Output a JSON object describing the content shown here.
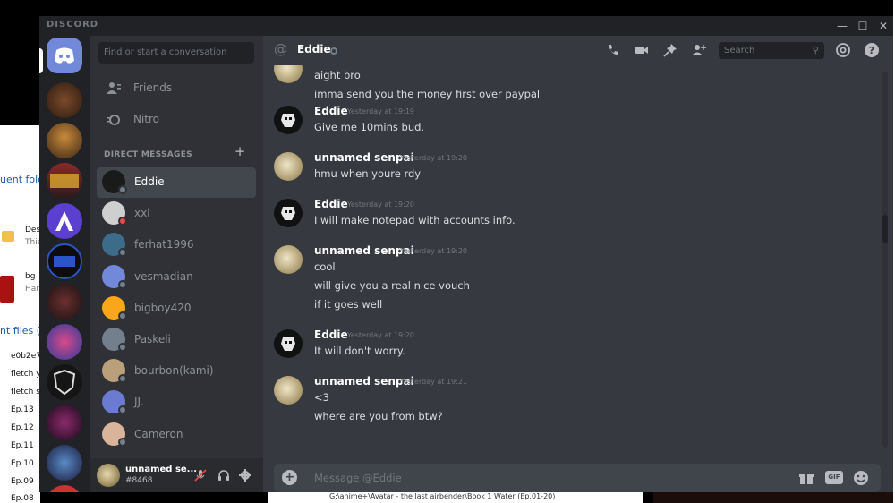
{
  "app": {
    "brand": "DISCORD"
  },
  "window_controls": {
    "minimize": "—",
    "maximize": "☐",
    "close": "✕"
  },
  "background": {
    "explorer_rows": [
      {
        "text": "uent fold",
        "top": 0
      },
      {
        "text": "Des",
        "top": 0
      },
      {
        "text": "This",
        "top": 0
      },
      {
        "text": "bg",
        "top": 0
      },
      {
        "text": "Har",
        "top": 0
      },
      {
        "text": "nt files (",
        "top": 0
      },
      {
        "text": "e0b2e7",
        "top": 0
      },
      {
        "text": "fletch y",
        "top": 0
      },
      {
        "text": "fletch s",
        "top": 0
      },
      {
        "text": "Ep.13",
        "top": 0
      },
      {
        "text": "Ep.12",
        "top": 0
      },
      {
        "text": "Ep.11",
        "top": 0
      },
      {
        "text": "Ep.10",
        "top": 0
      },
      {
        "text": "Ep.09",
        "top": 0
      },
      {
        "text": "Ep.08",
        "top": 0
      }
    ],
    "path_text": "G:\\anime+\\Avatar - the last airbender\\Book 1  Water (Ep.01-20)"
  },
  "sidebar": {
    "search_placeholder": "Find or start a conversation",
    "nav": [
      {
        "label": "Friends"
      },
      {
        "label": "Nitro"
      }
    ],
    "dm_header": "DIRECT MESSAGES",
    "dm_add": "+",
    "dms": [
      {
        "name": "Eddie",
        "active": true,
        "color": "#1a1a1a"
      },
      {
        "name": "xxl",
        "active": false,
        "color": "#cfcfcf",
        "status": "dnd"
      },
      {
        "name": "ferhat1996",
        "active": false,
        "color": "#3d6b8a"
      },
      {
        "name": "vesmadian",
        "active": false,
        "color": "#7289da"
      },
      {
        "name": "bigboy420",
        "active": false,
        "color": "#faa61a"
      },
      {
        "name": "Paskeli",
        "active": false,
        "color": "#747f8d"
      },
      {
        "name": "bourbon(kami)",
        "active": false,
        "color": "#b9a07a"
      },
      {
        "name": "JJ.",
        "active": false,
        "color": "#6a7bd1"
      },
      {
        "name": "Cameron",
        "active": false,
        "color": "#d9b49b"
      }
    ],
    "user": {
      "name": "unnamed se...",
      "tag": "#8468"
    }
  },
  "header": {
    "channel": "Eddie",
    "search_placeholder": "Search",
    "icons": [
      "call-icon",
      "video-icon",
      "pin-icon",
      "add-member-icon",
      "mention-icon",
      "help-icon"
    ]
  },
  "messages": [
    {
      "author": "",
      "time": "",
      "lines": [
        "aight bro",
        "imma send you the money first over paypal"
      ],
      "avatar": "senpai"
    },
    {
      "author": "Eddie",
      "time": "Yesterday at 19:19",
      "lines": [
        "Give me 10mins bud."
      ],
      "avatar": "eddie"
    },
    {
      "author": "unnamed senpai",
      "time": "Yesterday at 19:20",
      "lines": [
        "hmu when youre rdy"
      ],
      "avatar": "senpai"
    },
    {
      "author": "Eddie",
      "time": "Yesterday at 19:20",
      "lines": [
        "I will make notepad with accounts info."
      ],
      "avatar": "eddie"
    },
    {
      "author": "unnamed senpai",
      "time": "Yesterday at 19:20",
      "lines": [
        "cool",
        "will give you a real nice vouch",
        "if it goes well"
      ],
      "avatar": "senpai"
    },
    {
      "author": "Eddie",
      "time": "Yesterday at 19:20",
      "lines": [
        "It will don't worry."
      ],
      "avatar": "eddie"
    },
    {
      "author": "unnamed senpai",
      "time": "Yesterday at 19:21",
      "lines": [
        "<3",
        "where are you from btw?"
      ],
      "avatar": "senpai"
    }
  ],
  "composer": {
    "placeholder": "Message @Eddie",
    "gif": "GIF"
  },
  "colors": {
    "blurple": "#7289da",
    "dark": "#202225",
    "sidebar": "#2f3136",
    "chat": "#36393f"
  }
}
